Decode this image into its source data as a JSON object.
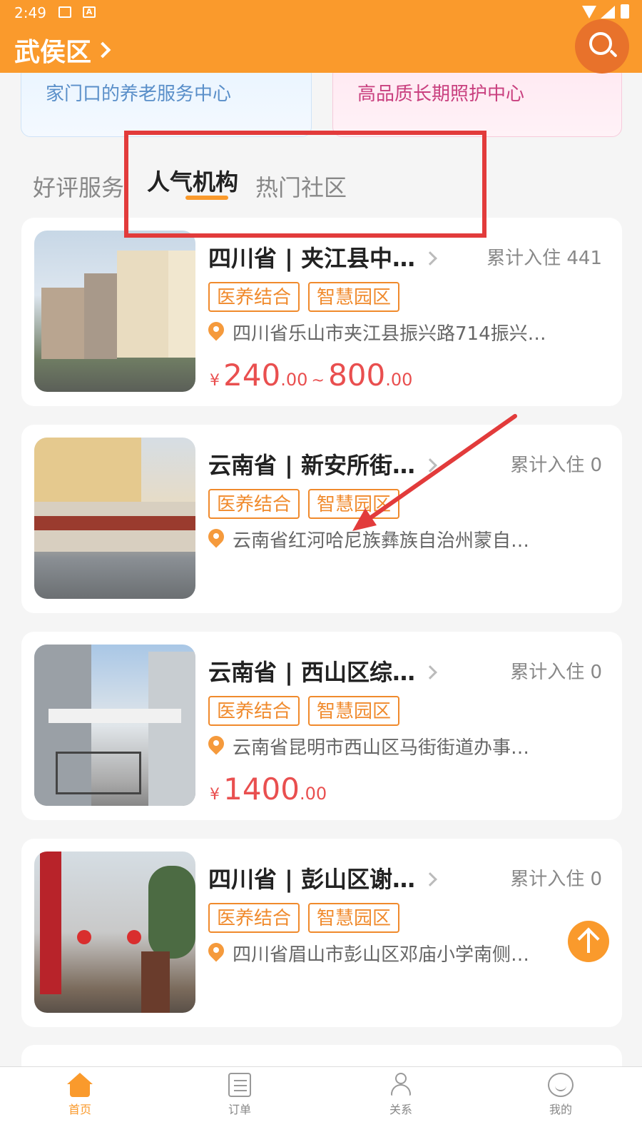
{
  "status_bar": {
    "time": "2:49",
    "a_icon_text": "A"
  },
  "header": {
    "location": "武侯区"
  },
  "banners": [
    {
      "text": "家门口的养老服务中心"
    },
    {
      "text": "高品质长期照护中心"
    }
  ],
  "tabs": [
    {
      "label": "好评服务",
      "active": false
    },
    {
      "label": "人气机构",
      "active": true
    },
    {
      "label": "热门社区",
      "active": false
    }
  ],
  "cards": [
    {
      "name": "四川省 | 夹江县中…",
      "stays": "累计入住 441",
      "tags": [
        "医养结合",
        "智慧园区"
      ],
      "address": "四川省乐山市夹江县振兴路714振兴…",
      "price": {
        "currency": "¥",
        "min_int": "240",
        "min_dec": ".00",
        "sep": "~",
        "max_int": "800",
        "max_dec": ".00"
      }
    },
    {
      "name": "云南省 | 新安所街…",
      "stays": "累计入住 0",
      "tags": [
        "医养结合",
        "智慧园区"
      ],
      "address": "云南省红河哈尼族彝族自治州蒙自…"
    },
    {
      "name": "云南省 | 西山区综…",
      "stays": "累计入住 0",
      "tags": [
        "医养结合",
        "智慧园区"
      ],
      "address": "云南省昆明市西山区马街街道办事…",
      "price": {
        "currency": "¥",
        "min_int": "1400",
        "min_dec": ".00"
      }
    },
    {
      "name": "四川省 | 彭山区谢…",
      "stays": "累计入住 0",
      "tags": [
        "医养结合",
        "智慧园区"
      ],
      "address": "四川省眉山市彭山区邓庙小学南侧…"
    }
  ],
  "bottom_nav": [
    {
      "label": "首页",
      "icon": "home-icon",
      "active": true
    },
    {
      "label": "订单",
      "icon": "order-icon",
      "active": false
    },
    {
      "label": "关系",
      "icon": "relation-icon",
      "active": false
    },
    {
      "label": "我的",
      "icon": "profile-icon",
      "active": false
    }
  ],
  "colors": {
    "accent": "#fa9a2c",
    "price": "#e94f4f",
    "annotation": "#e23b3b"
  }
}
